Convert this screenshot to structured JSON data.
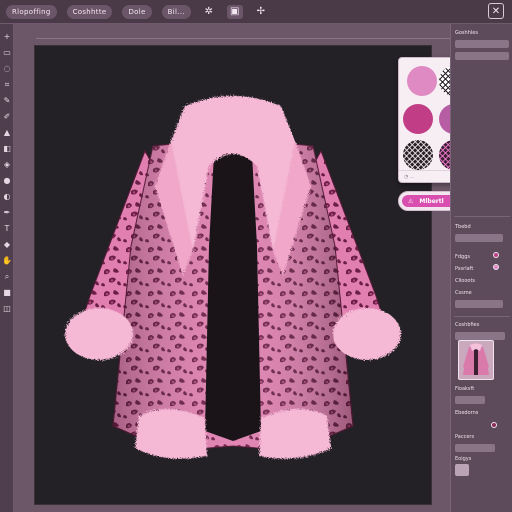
{
  "topbar": {
    "app_button": "Rlopoffing",
    "menu_create": "Coshhtte",
    "menu_edit": "Dole",
    "menu_view": "Bil...",
    "tools": [
      {
        "name": "magic-wand-icon",
        "glyph": "✲"
      },
      {
        "name": "picture-icon",
        "glyph": "▣"
      },
      {
        "name": "effects-icon",
        "glyph": "✢"
      }
    ],
    "close_glyph": "✕"
  },
  "right_panel": {
    "header": "Goshhles",
    "layers_label": "Coshbfies",
    "rows": [
      "Tbebd",
      "Fdggs",
      "Pssrlaft",
      "Cllooots",
      "Cssme",
      "Fioaksft",
      "Ebedorns",
      "Paccers",
      "Eoigys"
    ]
  },
  "swatch_popup": {
    "swatches": [
      {
        "name": "swatch-pink-lace",
        "color": "#e08ac4"
      },
      {
        "name": "swatch-white-check",
        "color": "#ffffff"
      },
      {
        "name": "swatch-dark-check",
        "color": "#3a2a34"
      },
      {
        "name": "swatch-magenta",
        "color": "#c13e86"
      },
      {
        "name": "swatch-orchid",
        "color": "#b65da4"
      },
      {
        "name": "swatch-leopard-dark",
        "color": "#2a2026"
      },
      {
        "name": "swatch-black-check",
        "color": "#20181c"
      },
      {
        "name": "swatch-rose-check",
        "color": "#3a2034"
      },
      {
        "name": "swatch-wine",
        "color": "#8a2a5a"
      }
    ],
    "footer": "◔ ..."
  },
  "fill_pill": {
    "label": "Mlbertl",
    "warning_glyph": "⚠",
    "action_glyph": "⇩"
  },
  "colors": {
    "accent": "#d94fb0",
    "canvas_bg": "#232126",
    "coat_pink": "#e586b5",
    "coat_dark": "#7a2a52",
    "fur": "#f5b8d5"
  }
}
